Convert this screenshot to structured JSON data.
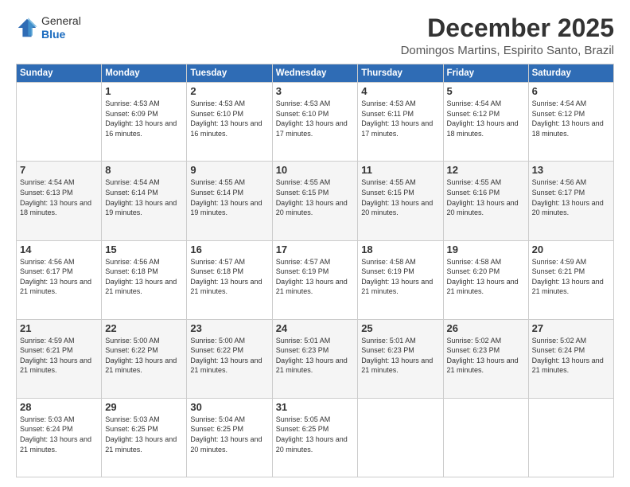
{
  "logo": {
    "general": "General",
    "blue": "Blue"
  },
  "title": "December 2025",
  "subtitle": "Domingos Martins, Espirito Santo, Brazil",
  "headers": [
    "Sunday",
    "Monday",
    "Tuesday",
    "Wednesday",
    "Thursday",
    "Friday",
    "Saturday"
  ],
  "weeks": [
    [
      {
        "day": "",
        "sunrise": "",
        "sunset": "",
        "daylight": ""
      },
      {
        "day": "1",
        "sunrise": "Sunrise: 4:53 AM",
        "sunset": "Sunset: 6:09 PM",
        "daylight": "Daylight: 13 hours and 16 minutes."
      },
      {
        "day": "2",
        "sunrise": "Sunrise: 4:53 AM",
        "sunset": "Sunset: 6:10 PM",
        "daylight": "Daylight: 13 hours and 16 minutes."
      },
      {
        "day": "3",
        "sunrise": "Sunrise: 4:53 AM",
        "sunset": "Sunset: 6:10 PM",
        "daylight": "Daylight: 13 hours and 17 minutes."
      },
      {
        "day": "4",
        "sunrise": "Sunrise: 4:53 AM",
        "sunset": "Sunset: 6:11 PM",
        "daylight": "Daylight: 13 hours and 17 minutes."
      },
      {
        "day": "5",
        "sunrise": "Sunrise: 4:54 AM",
        "sunset": "Sunset: 6:12 PM",
        "daylight": "Daylight: 13 hours and 18 minutes."
      },
      {
        "day": "6",
        "sunrise": "Sunrise: 4:54 AM",
        "sunset": "Sunset: 6:12 PM",
        "daylight": "Daylight: 13 hours and 18 minutes."
      }
    ],
    [
      {
        "day": "7",
        "sunrise": "Sunrise: 4:54 AM",
        "sunset": "Sunset: 6:13 PM",
        "daylight": "Daylight: 13 hours and 18 minutes."
      },
      {
        "day": "8",
        "sunrise": "Sunrise: 4:54 AM",
        "sunset": "Sunset: 6:14 PM",
        "daylight": "Daylight: 13 hours and 19 minutes."
      },
      {
        "day": "9",
        "sunrise": "Sunrise: 4:55 AM",
        "sunset": "Sunset: 6:14 PM",
        "daylight": "Daylight: 13 hours and 19 minutes."
      },
      {
        "day": "10",
        "sunrise": "Sunrise: 4:55 AM",
        "sunset": "Sunset: 6:15 PM",
        "daylight": "Daylight: 13 hours and 20 minutes."
      },
      {
        "day": "11",
        "sunrise": "Sunrise: 4:55 AM",
        "sunset": "Sunset: 6:15 PM",
        "daylight": "Daylight: 13 hours and 20 minutes."
      },
      {
        "day": "12",
        "sunrise": "Sunrise: 4:55 AM",
        "sunset": "Sunset: 6:16 PM",
        "daylight": "Daylight: 13 hours and 20 minutes."
      },
      {
        "day": "13",
        "sunrise": "Sunrise: 4:56 AM",
        "sunset": "Sunset: 6:17 PM",
        "daylight": "Daylight: 13 hours and 20 minutes."
      }
    ],
    [
      {
        "day": "14",
        "sunrise": "Sunrise: 4:56 AM",
        "sunset": "Sunset: 6:17 PM",
        "daylight": "Daylight: 13 hours and 21 minutes."
      },
      {
        "day": "15",
        "sunrise": "Sunrise: 4:56 AM",
        "sunset": "Sunset: 6:18 PM",
        "daylight": "Daylight: 13 hours and 21 minutes."
      },
      {
        "day": "16",
        "sunrise": "Sunrise: 4:57 AM",
        "sunset": "Sunset: 6:18 PM",
        "daylight": "Daylight: 13 hours and 21 minutes."
      },
      {
        "day": "17",
        "sunrise": "Sunrise: 4:57 AM",
        "sunset": "Sunset: 6:19 PM",
        "daylight": "Daylight: 13 hours and 21 minutes."
      },
      {
        "day": "18",
        "sunrise": "Sunrise: 4:58 AM",
        "sunset": "Sunset: 6:19 PM",
        "daylight": "Daylight: 13 hours and 21 minutes."
      },
      {
        "day": "19",
        "sunrise": "Sunrise: 4:58 AM",
        "sunset": "Sunset: 6:20 PM",
        "daylight": "Daylight: 13 hours and 21 minutes."
      },
      {
        "day": "20",
        "sunrise": "Sunrise: 4:59 AM",
        "sunset": "Sunset: 6:21 PM",
        "daylight": "Daylight: 13 hours and 21 minutes."
      }
    ],
    [
      {
        "day": "21",
        "sunrise": "Sunrise: 4:59 AM",
        "sunset": "Sunset: 6:21 PM",
        "daylight": "Daylight: 13 hours and 21 minutes."
      },
      {
        "day": "22",
        "sunrise": "Sunrise: 5:00 AM",
        "sunset": "Sunset: 6:22 PM",
        "daylight": "Daylight: 13 hours and 21 minutes."
      },
      {
        "day": "23",
        "sunrise": "Sunrise: 5:00 AM",
        "sunset": "Sunset: 6:22 PM",
        "daylight": "Daylight: 13 hours and 21 minutes."
      },
      {
        "day": "24",
        "sunrise": "Sunrise: 5:01 AM",
        "sunset": "Sunset: 6:23 PM",
        "daylight": "Daylight: 13 hours and 21 minutes."
      },
      {
        "day": "25",
        "sunrise": "Sunrise: 5:01 AM",
        "sunset": "Sunset: 6:23 PM",
        "daylight": "Daylight: 13 hours and 21 minutes."
      },
      {
        "day": "26",
        "sunrise": "Sunrise: 5:02 AM",
        "sunset": "Sunset: 6:23 PM",
        "daylight": "Daylight: 13 hours and 21 minutes."
      },
      {
        "day": "27",
        "sunrise": "Sunrise: 5:02 AM",
        "sunset": "Sunset: 6:24 PM",
        "daylight": "Daylight: 13 hours and 21 minutes."
      }
    ],
    [
      {
        "day": "28",
        "sunrise": "Sunrise: 5:03 AM",
        "sunset": "Sunset: 6:24 PM",
        "daylight": "Daylight: 13 hours and 21 minutes."
      },
      {
        "day": "29",
        "sunrise": "Sunrise: 5:03 AM",
        "sunset": "Sunset: 6:25 PM",
        "daylight": "Daylight: 13 hours and 21 minutes."
      },
      {
        "day": "30",
        "sunrise": "Sunrise: 5:04 AM",
        "sunset": "Sunset: 6:25 PM",
        "daylight": "Daylight: 13 hours and 20 minutes."
      },
      {
        "day": "31",
        "sunrise": "Sunrise: 5:05 AM",
        "sunset": "Sunset: 6:25 PM",
        "daylight": "Daylight: 13 hours and 20 minutes."
      },
      {
        "day": "",
        "sunrise": "",
        "sunset": "",
        "daylight": ""
      },
      {
        "day": "",
        "sunrise": "",
        "sunset": "",
        "daylight": ""
      },
      {
        "day": "",
        "sunrise": "",
        "sunset": "",
        "daylight": ""
      }
    ]
  ]
}
